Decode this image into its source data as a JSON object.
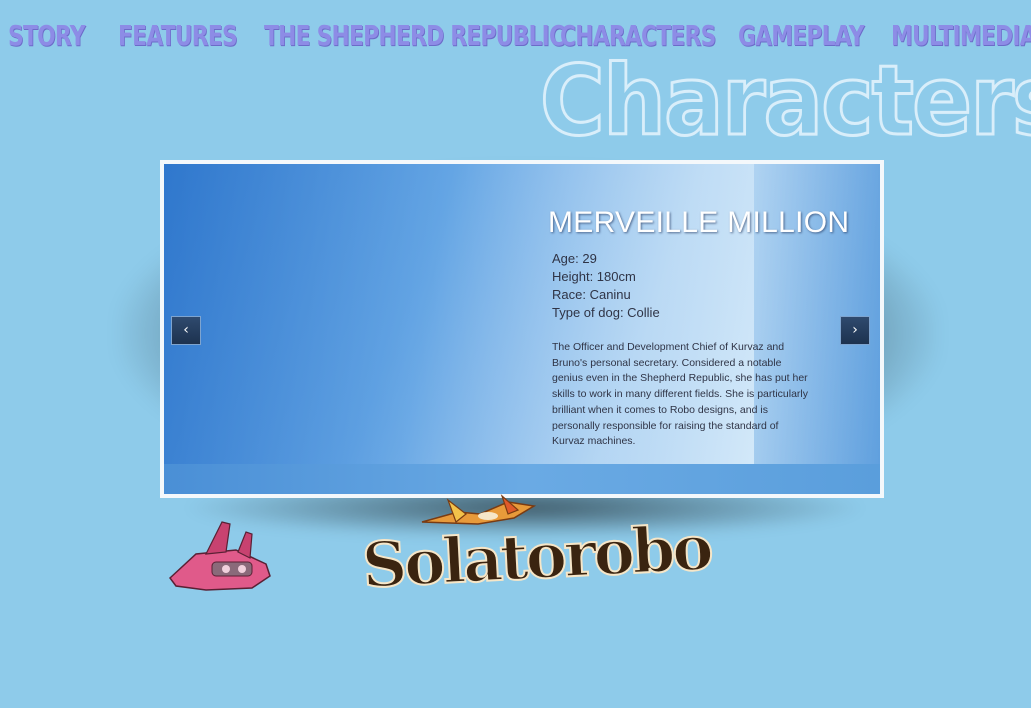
{
  "nav": {
    "items": [
      {
        "label": "Story"
      },
      {
        "label": "Features"
      },
      {
        "label": "The Shepherd Republic"
      },
      {
        "label": "Characters"
      },
      {
        "label": "Gameplay"
      },
      {
        "label": "Multimedia"
      }
    ]
  },
  "section": {
    "heading": "Characters"
  },
  "slide": {
    "name": "MERVEILLE MILLION",
    "stats": [
      "Age: 29",
      "Height: 180cm",
      "Race: Caninu",
      "Type of dog: Collie"
    ],
    "bio": "The Officer and Development Chief of Kurvaz and Bruno's personal secretary. Considered a notable genius even in the Shepherd Republic, she has put her skills to work in many different fields. She is particularly brilliant when it comes to Robo designs, and is personally responsible for raising the standard of Kurvaz machines."
  },
  "controls": {
    "prev_icon": "chevron-left-icon",
    "next_icon": "chevron-right-icon",
    "prev_glyph": "‹",
    "next_glyph": "›"
  },
  "logo": {
    "text": "Solatorobo"
  },
  "colors": {
    "background": "#8ecbea",
    "nav": "#8d8ce6",
    "frame": "#f4f8fb",
    "button": "#1d324f"
  }
}
